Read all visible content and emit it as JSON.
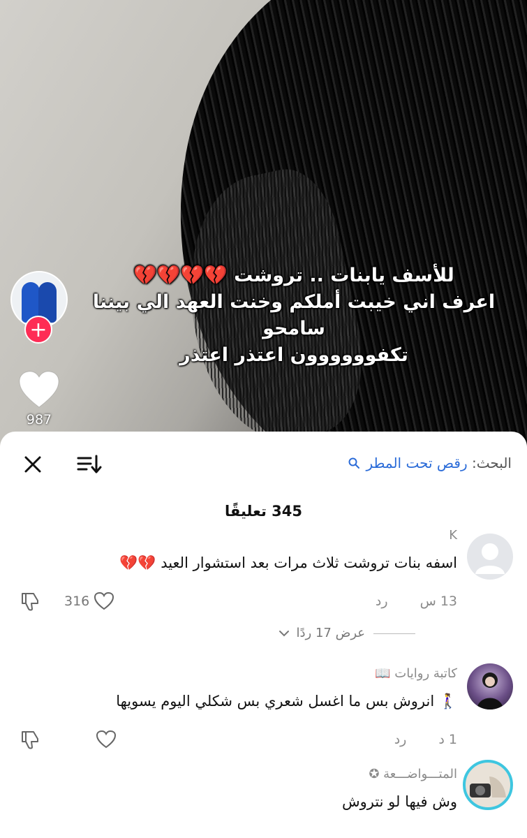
{
  "video": {
    "caption_lines": [
      "للأسف يابنات .. تروشت 💔💔💔💔",
      "اعرف اني خيبت أملكم وخنت العهد الي بيننا سامحو",
      "تكفوووووون اعتذر اعتذر"
    ],
    "like_count": "987",
    "colors": {
      "follow": "#fe2c55"
    }
  },
  "sheet": {
    "search_label": "البحث:",
    "search_query": "رقص تحت المطر",
    "comments_count": "345 تعليقًا",
    "comments": [
      {
        "name": "K",
        "text": "اسفه بنات تروشت ثلاث مرات بعد استشوار العيد 💔💔",
        "time": "13 س",
        "reply": "رد",
        "likes": "316",
        "view_replies": "عرض 17 ردًا"
      },
      {
        "name": "كاتبة روايات 📖",
        "text": "🚶‍♀️ انروش بس ما اغسل شعري بس شكلي اليوم يسويها",
        "time": "1 د",
        "reply": "رد",
        "likes": ""
      },
      {
        "name": "المتـــواضـــعة ✪",
        "text": "وش فيها لو نتروش",
        "time": "",
        "reply": "",
        "likes": ""
      }
    ],
    "colors": {
      "link": "#2a6bd8",
      "meta": "#8a8a8a"
    }
  },
  "icons": [
    "close-icon",
    "sort-icon",
    "search-icon",
    "heart-icon",
    "dislike-icon",
    "plus-icon",
    "chevron-down-icon"
  ]
}
